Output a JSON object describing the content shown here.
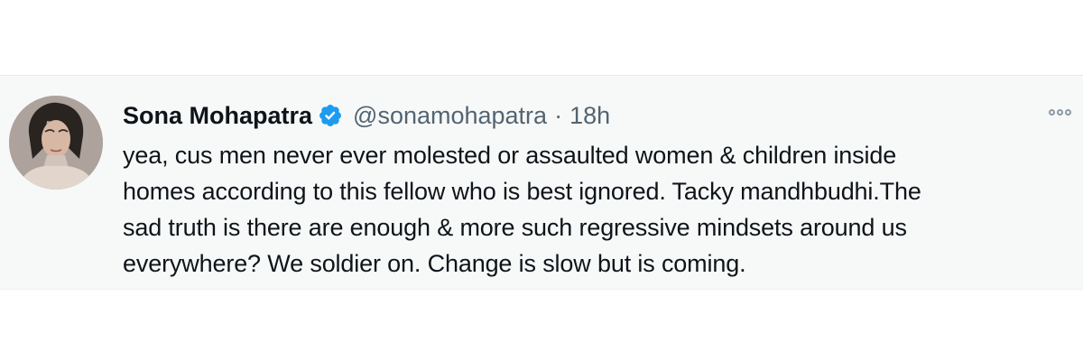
{
  "tweet": {
    "author": {
      "display_name": "Sona Mohapatra",
      "handle": "@sonamohapatra",
      "verified": true
    },
    "separator": "·",
    "timestamp": "18h",
    "text": "yea, cus men never ever molested or assaulted women & children inside\nhomes according to this fellow who is best ignored. Tacky mandhbudhi.The\nsad truth is there are enough & more such regressive mindsets around us\neverywhere? We soldier on. Change is slow but is coming."
  },
  "icons": {
    "verified": "verified-badge-icon",
    "more": "more-options-icon",
    "avatar": "profile-avatar"
  },
  "colors": {
    "card_background": "#f7f9f9",
    "text_primary": "#0f1419",
    "text_secondary": "#536471",
    "verified_blue": "#1d9bf0"
  }
}
